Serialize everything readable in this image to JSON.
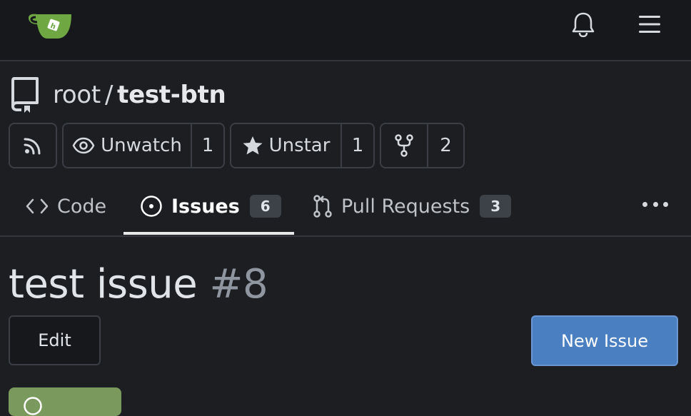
{
  "repo": {
    "owner": "root",
    "separator": "/",
    "name": "test-btn"
  },
  "actions": {
    "watch_label": "Unwatch",
    "watch_count": "1",
    "star_label": "Unstar",
    "star_count": "1",
    "fork_count": "2"
  },
  "tabs": [
    {
      "label": "Code",
      "icon": "code-icon"
    },
    {
      "label": "Issues",
      "icon": "issue-open-icon",
      "count": "6",
      "active": true
    },
    {
      "label": "Pull Requests",
      "icon": "git-pull-request-icon",
      "count": "3"
    }
  ],
  "issue": {
    "title": "test issue",
    "number": "#8"
  },
  "buttons": {
    "edit": "Edit",
    "new_issue": "New Issue"
  },
  "colors": {
    "primary": "#4a7fc2",
    "open_state": "#7a9a5d",
    "background": "#1c1e22"
  },
  "icons": [
    "gitea-logo",
    "bell-icon",
    "menu-icon",
    "repo-icon",
    "rss-icon",
    "eye-icon",
    "star-icon",
    "fork-icon",
    "kebab-horizontal-icon"
  ]
}
